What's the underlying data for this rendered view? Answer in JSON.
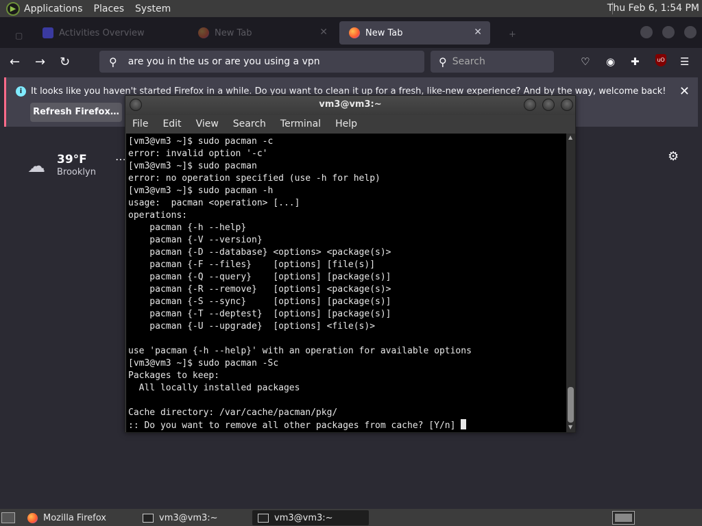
{
  "top_panel": {
    "menus": [
      "Applications",
      "Places",
      "System"
    ],
    "clock": "Thu Feb 6, 1:54 PM"
  },
  "firefox": {
    "tabs": [
      {
        "label": "Activities Overview"
      },
      {
        "label": "New Tab"
      },
      {
        "label": "New Tab"
      }
    ],
    "url": "are you in the us or are you using a vpn",
    "search_placeholder": "Search",
    "notification": {
      "message": "It looks like you haven't started Firefox in a while. Do you want to clean it up for a fresh, like-new experience? And by the way, welcome back!",
      "button": "Refresh Firefox…"
    },
    "weather": {
      "temperature": "39°F",
      "location": "Brooklyn"
    },
    "ublock_label": "uO"
  },
  "terminal": {
    "title": "vm3@vm3:~",
    "menu": [
      "File",
      "Edit",
      "View",
      "Search",
      "Terminal",
      "Help"
    ],
    "lines": [
      "[vm3@vm3 ~]$ sudo pacman -c",
      "error: invalid option '-c'",
      "[vm3@vm3 ~]$ sudo pacman",
      "error: no operation specified (use -h for help)",
      "[vm3@vm3 ~]$ sudo pacman -h",
      "usage:  pacman <operation> [...]",
      "operations:",
      "    pacman {-h --help}",
      "    pacman {-V --version}",
      "    pacman {-D --database} <options> <package(s)>",
      "    pacman {-F --files}    [options] [file(s)]",
      "    pacman {-Q --query}    [options] [package(s)]",
      "    pacman {-R --remove}   [options] <package(s)>",
      "    pacman {-S --sync}     [options] [package(s)]",
      "    pacman {-T --deptest}  [options] [package(s)]",
      "    pacman {-U --upgrade}  [options] <file(s)>",
      "",
      "use 'pacman {-h --help}' with an operation for available options",
      "[vm3@vm3 ~]$ sudo pacman -Sc",
      "Packages to keep:",
      "  All locally installed packages",
      "",
      "Cache directory: /var/cache/pacman/pkg/",
      ":: Do you want to remove all other packages from cache? [Y/n] "
    ]
  },
  "taskbar": {
    "items": [
      {
        "label": "Mozilla Firefox"
      },
      {
        "label": "vm3@vm3:~"
      },
      {
        "label": "vm3@vm3:~"
      }
    ]
  }
}
